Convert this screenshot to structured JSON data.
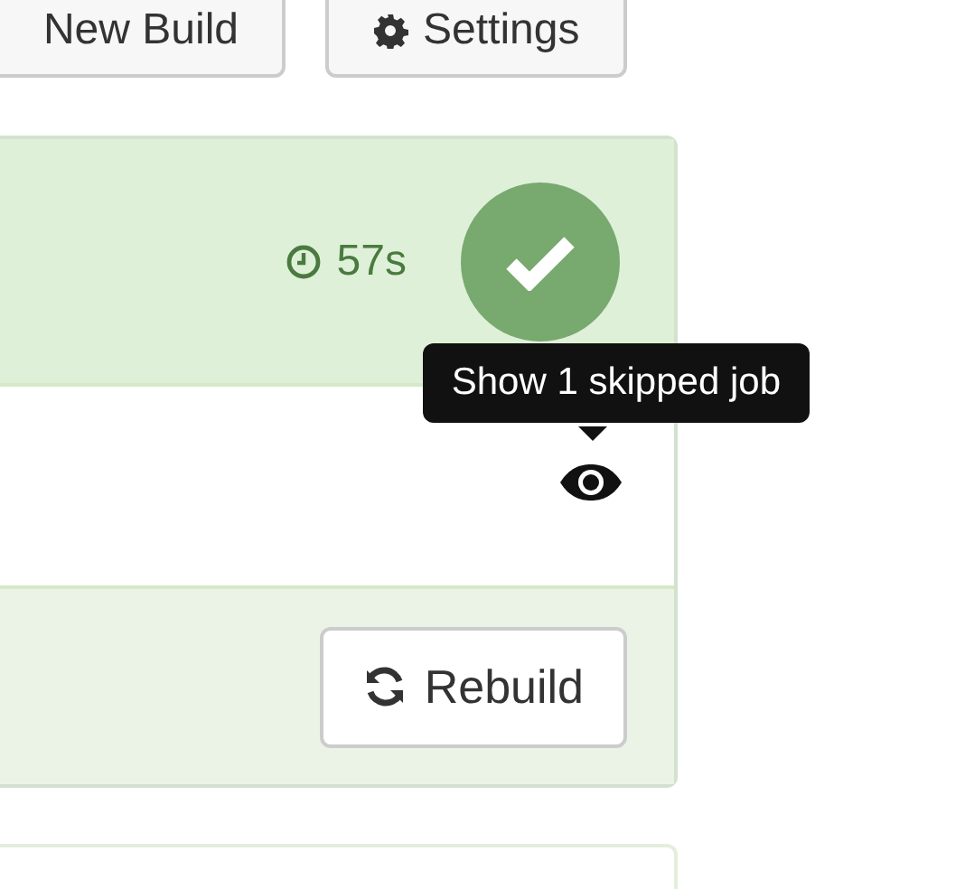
{
  "toolbar": {
    "buttons": [
      {
        "label": "New Build",
        "kind": "plain"
      },
      {
        "label": "Settings",
        "kind": "settings"
      }
    ]
  },
  "build": {
    "passed": true,
    "duration": "57s",
    "tooltip": "Show 1 skipped job",
    "rebuild_label": "Rebuild"
  }
}
